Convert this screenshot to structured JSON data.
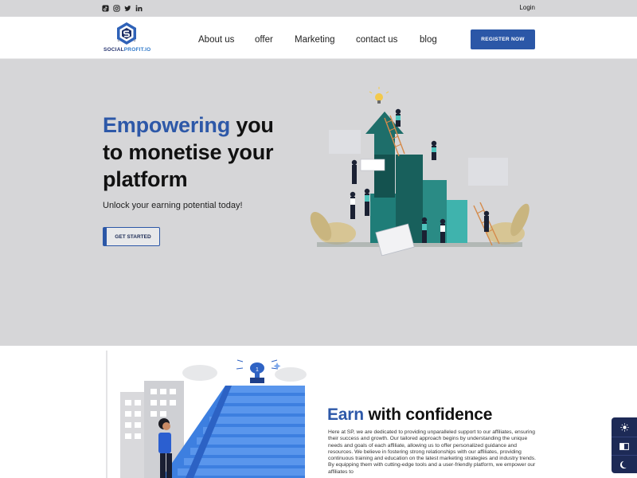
{
  "topbar": {
    "social": [
      {
        "name": "tiktok-icon"
      },
      {
        "name": "instagram-icon"
      },
      {
        "name": "twitter-icon"
      },
      {
        "name": "linkedin-icon"
      }
    ],
    "login": "Login"
  },
  "nav": {
    "logo_text_main": "SOCIAL",
    "logo_text_accent": "PROFIT.IO",
    "links": [
      "About us",
      "offer",
      "Marketing",
      "contact us",
      "blog"
    ],
    "register": "REGISTER NOW"
  },
  "hero": {
    "title_accent": "Empowering",
    "title_line1_rest": " you",
    "title_line2": "to monetise your",
    "title_line3": "platform",
    "subtitle": "Unlock your earning potential today!",
    "cta": "GET STARTED"
  },
  "section2": {
    "title_accent": "Earn",
    "title_rest": " with confidence",
    "trophy_number": "1",
    "body": "Here at SP, we are dedicated to providing unparalleled support to our affiliates, ensuring their success and growth. Our tailored approach begins by understanding the unique needs and goals of each affiliate, allowing us to offer personalized guidance and resources. We believe in fostering strong relationships with our affiliates, providing continuous training and education on the latest marketing strategies and industry trends. By equipping them with cutting-edge tools and a user-friendly platform, we empower our affiliates to"
  },
  "side_tools": [
    {
      "name": "sun-icon"
    },
    {
      "name": "contrast-toggle-icon"
    },
    {
      "name": "moon-icon"
    }
  ],
  "colors": {
    "brand_blue": "#2b57a7",
    "navy": "#1d2a56",
    "hero_bg": "#d6d6d8",
    "teal": "#1c6f6b"
  }
}
